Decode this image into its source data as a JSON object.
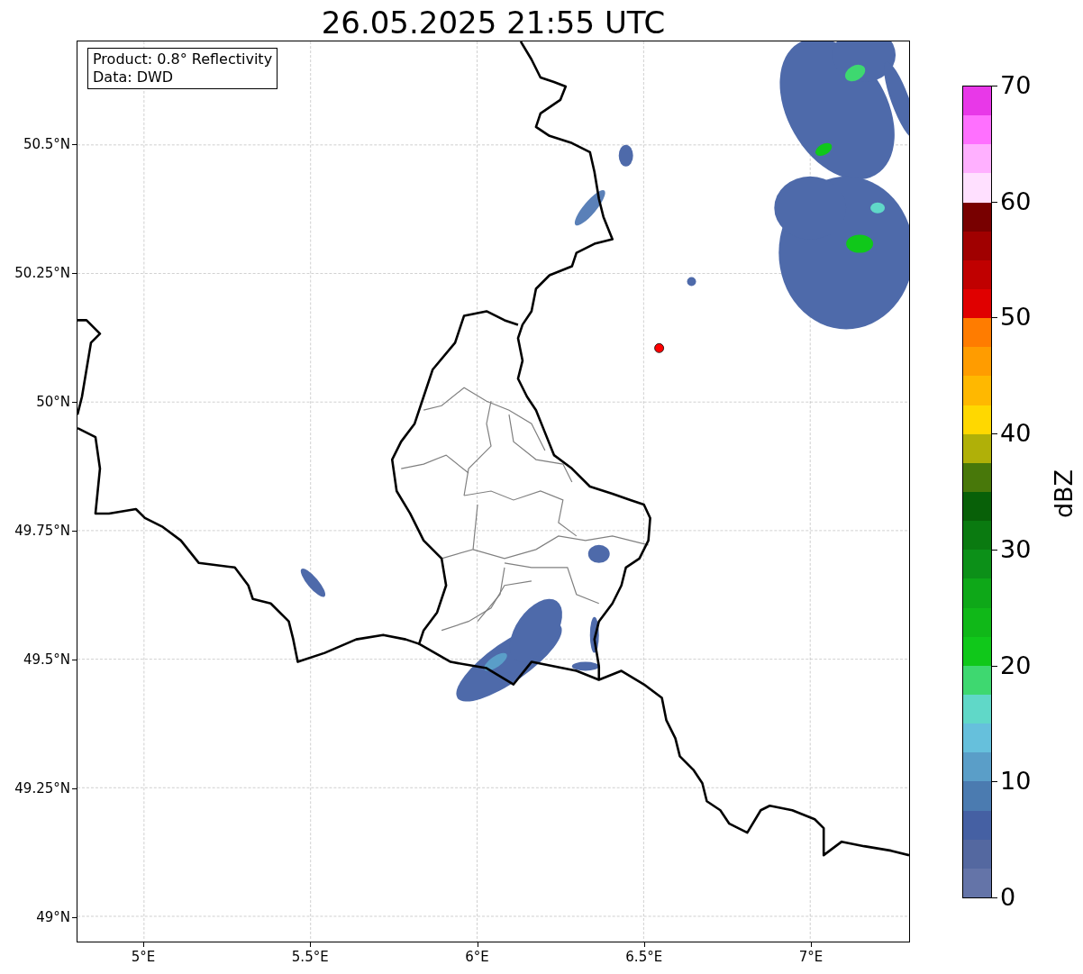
{
  "title": "26.05.2025 21:55 UTC",
  "info_box": {
    "lines": [
      "Product: 0.8° Reflectivity",
      "Data: DWD"
    ]
  },
  "map": {
    "x_ticks": [
      "5°E",
      "5.5°E",
      "6°E",
      "6.5°E",
      "7°E"
    ],
    "y_ticks": [
      "50.5°N",
      "50.25°N",
      "50°N",
      "49.75°N",
      "49.5°N",
      "49.25°N",
      "49°N"
    ]
  },
  "colorbar": {
    "label": "dBZ",
    "ticks": [
      "70",
      "60",
      "50",
      "40",
      "30",
      "20",
      "10",
      "0"
    ],
    "bands": [
      {
        "color": "#e838e8"
      },
      {
        "color": "#ff70ff"
      },
      {
        "color": "#ffb0ff"
      },
      {
        "color": "#ffe0ff"
      },
      {
        "color": "#780000"
      },
      {
        "color": "#a00000"
      },
      {
        "color": "#c00000"
      },
      {
        "color": "#e00000"
      },
      {
        "color": "#ff7c00"
      },
      {
        "color": "#ff9c00"
      },
      {
        "color": "#ffb800"
      },
      {
        "color": "#ffd800"
      },
      {
        "color": "#b0b008"
      },
      {
        "color": "#48780a"
      },
      {
        "color": "#086008"
      },
      {
        "color": "#0a7a10"
      },
      {
        "color": "#0c9018"
      },
      {
        "color": "#0ea818"
      },
      {
        "color": "#10b818"
      },
      {
        "color": "#10c81a"
      },
      {
        "color": "#3ed870"
      },
      {
        "color": "#60d8c8"
      },
      {
        "color": "#66c0dc"
      },
      {
        "color": "#5a9ec8"
      },
      {
        "color": "#4b7bb0"
      },
      {
        "color": "#4560a3"
      },
      {
        "color": "#5468a0"
      },
      {
        "color": "#6474a8"
      }
    ]
  }
}
